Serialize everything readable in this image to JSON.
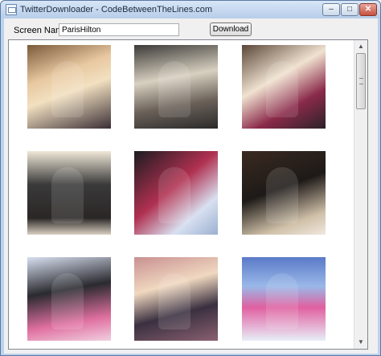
{
  "window": {
    "title": "TwitterDownloader - CodeBetweenTheLines.com",
    "buttons": {
      "minimize": "–",
      "maximize": "□",
      "close": "✕"
    }
  },
  "form": {
    "screen_name_label": "Screen Name",
    "screen_name_value": "ParisHilton",
    "download_label": "Download"
  },
  "gallery": {
    "photos": [
      {
        "name": "photo-1"
      },
      {
        "name": "photo-2"
      },
      {
        "name": "photo-3"
      },
      {
        "name": "photo-4"
      },
      {
        "name": "photo-5"
      },
      {
        "name": "photo-6"
      },
      {
        "name": "photo-7"
      },
      {
        "name": "photo-8"
      },
      {
        "name": "photo-9"
      }
    ],
    "scrollbar": {
      "up_arrow": "▲",
      "down_arrow": "▼"
    }
  },
  "icons": {
    "app": "app-window-icon",
    "minimize": "minimize-icon",
    "maximize": "maximize-icon",
    "close": "close-icon"
  }
}
